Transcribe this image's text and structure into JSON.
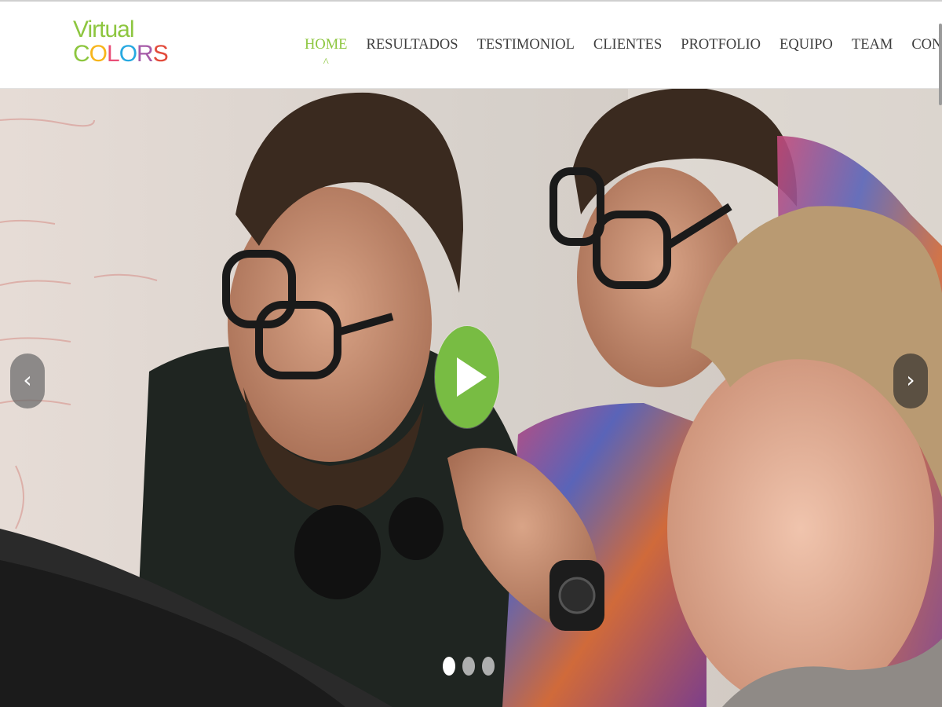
{
  "brand": {
    "line1": "Virtual",
    "line2_letters": [
      {
        "ch": "C",
        "color": "#8dc63f"
      },
      {
        "ch": "O",
        "color": "#f7b51c"
      },
      {
        "ch": "L",
        "color": "#e94e77"
      },
      {
        "ch": "O",
        "color": "#27a9e1"
      },
      {
        "ch": "R",
        "color": "#a65ba8"
      },
      {
        "ch": "S",
        "color": "#e24b3b"
      }
    ]
  },
  "nav": {
    "items": [
      {
        "label": "HOME",
        "active": true
      },
      {
        "label": "RESULTADOS"
      },
      {
        "label": "TESTIMONIOL"
      },
      {
        "label": "CLIENTES"
      },
      {
        "label": "PROTFOLIO"
      },
      {
        "label": "EQUIPO"
      },
      {
        "label": "TEAM"
      },
      {
        "label": "CONTACT"
      }
    ],
    "active_caret": "^"
  },
  "slider": {
    "prev_symbol": "‹",
    "next_symbol": "›",
    "slide_count": 3,
    "active_index": 0,
    "play_icon": "play-icon"
  },
  "colors": {
    "accent_green": "#8dc63f",
    "play_green": "#78bc43",
    "nav_text": "#3d3d3d"
  }
}
